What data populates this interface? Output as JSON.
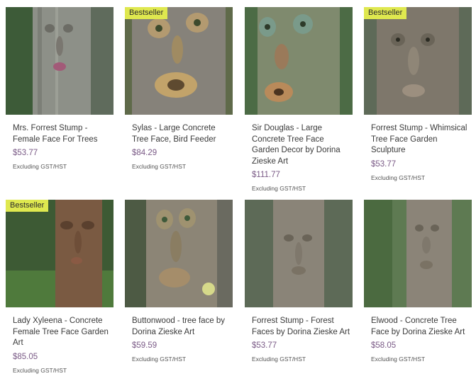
{
  "products": [
    {
      "title": "Mrs. Forrest Stump - Female Face For Trees",
      "price": "$53.77",
      "note": "Excluding GST/HST",
      "badge": ""
    },
    {
      "title": "Sylas - Large Concrete Tree Face, Bird Feeder",
      "price": "$84.29",
      "note": "Excluding GST/HST",
      "badge": "Bestseller"
    },
    {
      "title": "Sir Douglas - Large Concrete Tree Face Garden Decor by Dorina Zieske Art",
      "price": "$111.77",
      "note": "Excluding GST/HST",
      "badge": ""
    },
    {
      "title": "Forrest Stump - Whimsical Tree Face Garden Sculpture",
      "price": "$53.77",
      "note": "Excluding GST/HST",
      "badge": "Bestseller"
    },
    {
      "title": "Lady Xyleena - Concrete Female Tree Face Garden Art",
      "price": "$85.05",
      "note": "Excluding GST/HST",
      "badge": "Bestseller"
    },
    {
      "title": "Buttonwood - tree face by Dorina Zieske Art",
      "price": "$59.59",
      "note": "Excluding GST/HST",
      "badge": ""
    },
    {
      "title": "Forrest Stump - Forest Faces by Dorina Zieske Art",
      "price": "$53.77",
      "note": "Excluding GST/HST",
      "badge": ""
    },
    {
      "title": "Elwood - Concrete Tree Face by Dorina Zieske Art",
      "price": "$58.05",
      "note": "Excluding GST/HST",
      "badge": ""
    }
  ]
}
